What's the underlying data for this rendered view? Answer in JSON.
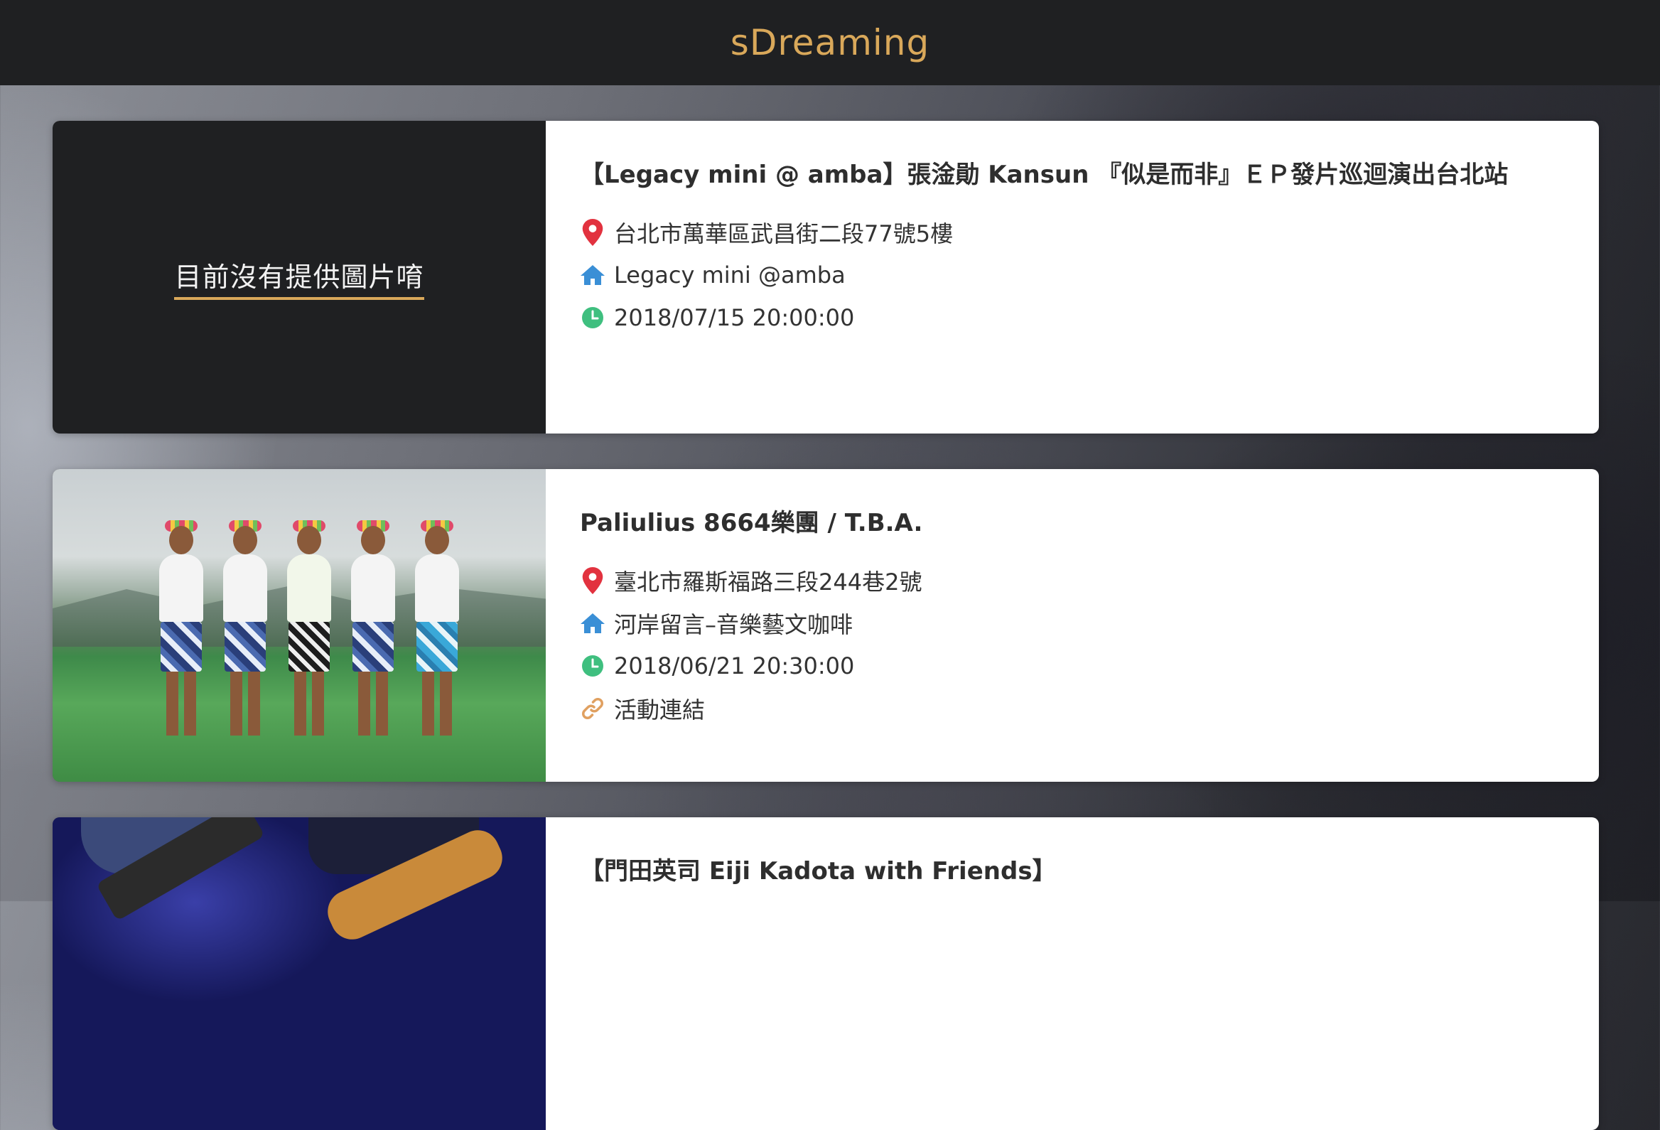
{
  "brand": "sDreaming",
  "events": [
    {
      "title": "【Legacy mini @ amba】張淦勛 Kansun 『似是而非』ＥＰ發片巡迴演出台北站",
      "address": "台北市萬華區武昌街二段77號5樓",
      "venue": "Legacy mini @amba",
      "datetime": "2018/07/15 20:00:00",
      "no_image_text": "目前沒有提供圖片唷"
    },
    {
      "title": "Paliulius 8664樂團 / T.B.A.",
      "address": "臺北市羅斯福路三段244巷2號",
      "venue": "河岸留言–音樂藝文咖啡",
      "datetime": "2018/06/21 20:30:00",
      "link_label": "活動連結"
    },
    {
      "title": "【門田英司 Eiji Kadota with Friends】"
    }
  ],
  "icons": {
    "location": "map-marker-icon",
    "venue": "home-icon",
    "time": "clock-icon",
    "link": "link-icon"
  },
  "colors": {
    "brand": "#d9a85a",
    "marker": "#e2323f",
    "home": "#3a8fd6",
    "clock": "#3fbf7f",
    "link": "#e0a060",
    "topbar": "#1f2022"
  }
}
